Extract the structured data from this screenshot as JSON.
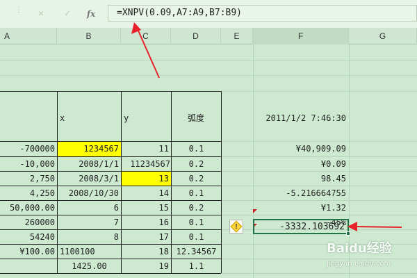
{
  "formula_bar": {
    "cancel_icon": "✕",
    "enter_icon": "✓",
    "fx_label": "fx",
    "formula": "=XNPV(0.09,A7:A9,B7:B9)"
  },
  "columns": [
    "A",
    "B",
    "C",
    "D",
    "E",
    "F",
    "G"
  ],
  "table": {
    "header": {
      "b": "x",
      "c": "y",
      "d": "弧度"
    },
    "rows": [
      {
        "a": "-700000",
        "b": "1234567",
        "c": "11",
        "d": "0.1"
      },
      {
        "a": "-10,000",
        "b": "2008/1/1",
        "c": "11234567",
        "d": "0.2"
      },
      {
        "a": "2,750",
        "b": "2008/3/1",
        "c": "13",
        "d": "0.2"
      },
      {
        "a": "4,250",
        "b": "2008/10/30",
        "c": "14",
        "d": "0.1"
      },
      {
        "a": "50,000.00",
        "b": "6",
        "c": "15",
        "d": "0.2"
      },
      {
        "a": "260000",
        "b": "7",
        "c": "16",
        "d": "0.1"
      },
      {
        "a": "54240",
        "b": "8",
        "c": "17",
        "d": "0.1"
      },
      {
        "a": "¥100.00",
        "b": "1100100",
        "c": "18",
        "d": "12.34567"
      },
      {
        "a": "",
        "b": "1425.00",
        "c": "19",
        "d": "1.1"
      }
    ]
  },
  "column_f": [
    "2011/1/2 7:46:30",
    "¥40,909.09",
    "¥0.09",
    "98.45",
    "-5.216664755",
    "¥1.32",
    "-45%",
    "-3332.103692"
  ],
  "warning_icon": "!",
  "watermark": {
    "brand": "Baidu经验",
    "url": "jingyan.baidu.com"
  },
  "colors": {
    "arrow": "#e8212a",
    "highlight": "#ffff00",
    "selected_border": "#217346"
  }
}
